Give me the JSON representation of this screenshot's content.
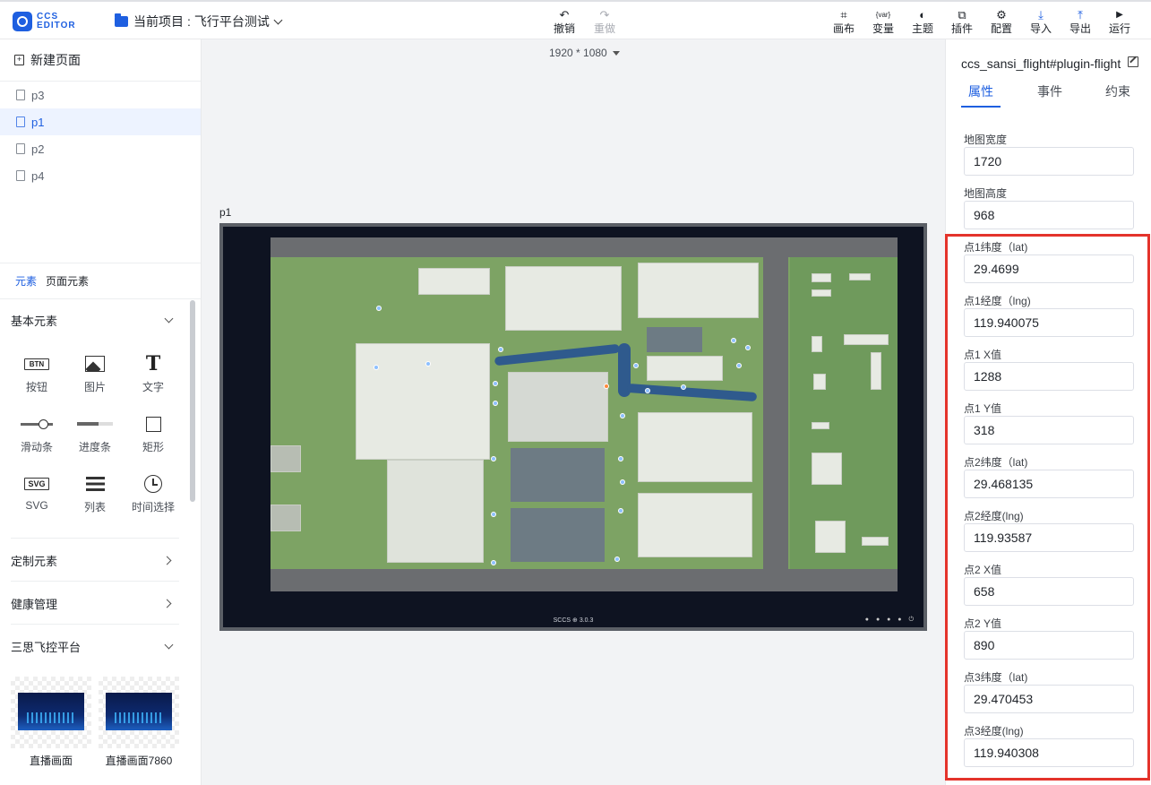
{
  "app": {
    "logo_text_1": "CCS",
    "logo_text_2": "EDITOR",
    "project_label": "当前项目",
    "project_sep": ":",
    "project_name": "飞行平台测试"
  },
  "toolbar": {
    "undo": {
      "icon": "↶",
      "label": "撤销"
    },
    "redo": {
      "icon": "↷",
      "label": "重做"
    },
    "right": [
      {
        "name": "canvas",
        "icon": "⌗",
        "label": "画布"
      },
      {
        "name": "variable",
        "icon": "{var}",
        "label": "变量"
      },
      {
        "name": "theme",
        "icon": "◐",
        "label": "主题"
      },
      {
        "name": "plugin",
        "icon": "⧉",
        "label": "插件"
      },
      {
        "name": "config",
        "icon": "⚙",
        "label": "配置"
      },
      {
        "name": "import",
        "icon": "⤓",
        "label": "导入"
      },
      {
        "name": "export",
        "icon": "⤒",
        "label": "导出"
      },
      {
        "name": "run",
        "icon": "▶",
        "label": "运行"
      }
    ]
  },
  "left": {
    "new_page": "新建页面",
    "pages": [
      "p3",
      "p1",
      "p2",
      "p4"
    ],
    "active_page": "p1",
    "tabs": [
      "元素",
      "页面元素"
    ],
    "basic_section": "基本元素",
    "components": [
      "按钮",
      "图片",
      "文字",
      "滑动条",
      "进度条",
      "矩形",
      "SVG",
      "列表",
      "时间选择"
    ],
    "btn_icon_text": "BTN",
    "svg_icon_text": "SVG",
    "custom_section": "定制元素",
    "health_section": "健康管理",
    "flight_section": "三思飞控平台",
    "thumbs": [
      "直播画面",
      "直播画面7860"
    ]
  },
  "canvas": {
    "resolution": "1920 * 1080",
    "page_label": "p1",
    "footer": "SCCS ⊕ 3.0.3",
    "dots": "● ● ● ● ⏻"
  },
  "right": {
    "title": "ccs_sansi_flight#plugin-flight",
    "tabs": [
      "属性",
      "事件",
      "约束"
    ],
    "fields": [
      {
        "label": "地图宽度",
        "value": "1720"
      },
      {
        "label": "地图高度",
        "value": "968"
      },
      {
        "label": "点1纬度（lat)",
        "value": "29.4699"
      },
      {
        "label": "点1经度（lng)",
        "value": "119.940075"
      },
      {
        "label": "点1 X值",
        "value": "1288"
      },
      {
        "label": "点1 Y值",
        "value": "318"
      },
      {
        "label": "点2纬度（lat)",
        "value": "29.468135"
      },
      {
        "label": "点2经度(lng)",
        "value": "119.93587"
      },
      {
        "label": "点2 X值",
        "value": "658"
      },
      {
        "label": "点2 Y值",
        "value": "890"
      },
      {
        "label": "点3纬度（lat)",
        "value": "29.470453"
      },
      {
        "label": "点3经度(lng)",
        "value": "119.940308"
      }
    ]
  },
  "colors": {
    "accent": "#1e5fe0",
    "highlight": "#e4332b"
  }
}
